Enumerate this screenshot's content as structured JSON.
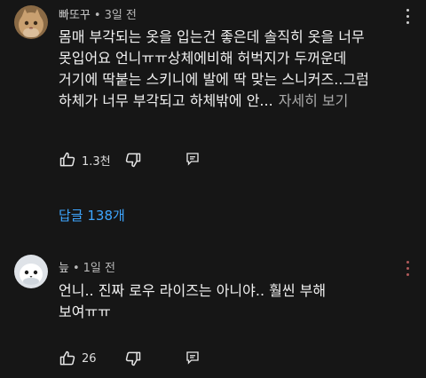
{
  "comments": [
    {
      "author": "빠또꾸",
      "time": "3일 전",
      "avatar_icon": "cat-avatar-icon",
      "lines": [
        "몸매 부각되는 옷을 입는건 좋은데 솔직히 옷을 너무",
        "못입어요 언니ㅠㅠ상체에비해 허벅지가 두꺼운데",
        "거기에 딱붙는 스키니에 발에 딱 맞는 스니커즈..그럼",
        "하체가 너무 부각되고 하체밖에 안..."
      ],
      "more_label": "자세히 보기",
      "likes": "1.3천",
      "reply_count_label": "답글 138개"
    },
    {
      "author": "늪",
      "time": "1일 전",
      "avatar_icon": "bird-avatar-icon",
      "lines": [
        "언니.. 진짜 로우 라이즈는 아니야.. 훨씬 부해",
        "보여ㅠㅠ"
      ],
      "likes": "26"
    }
  ],
  "colors": {
    "background": "#161616",
    "text": "#f1f1f1",
    "secondary": "#aaaaaa",
    "link": "#3ea6ff"
  },
  "icons": [
    "thumbs-up-icon",
    "thumbs-down-icon",
    "reply-icon",
    "more-vert-icon"
  ]
}
